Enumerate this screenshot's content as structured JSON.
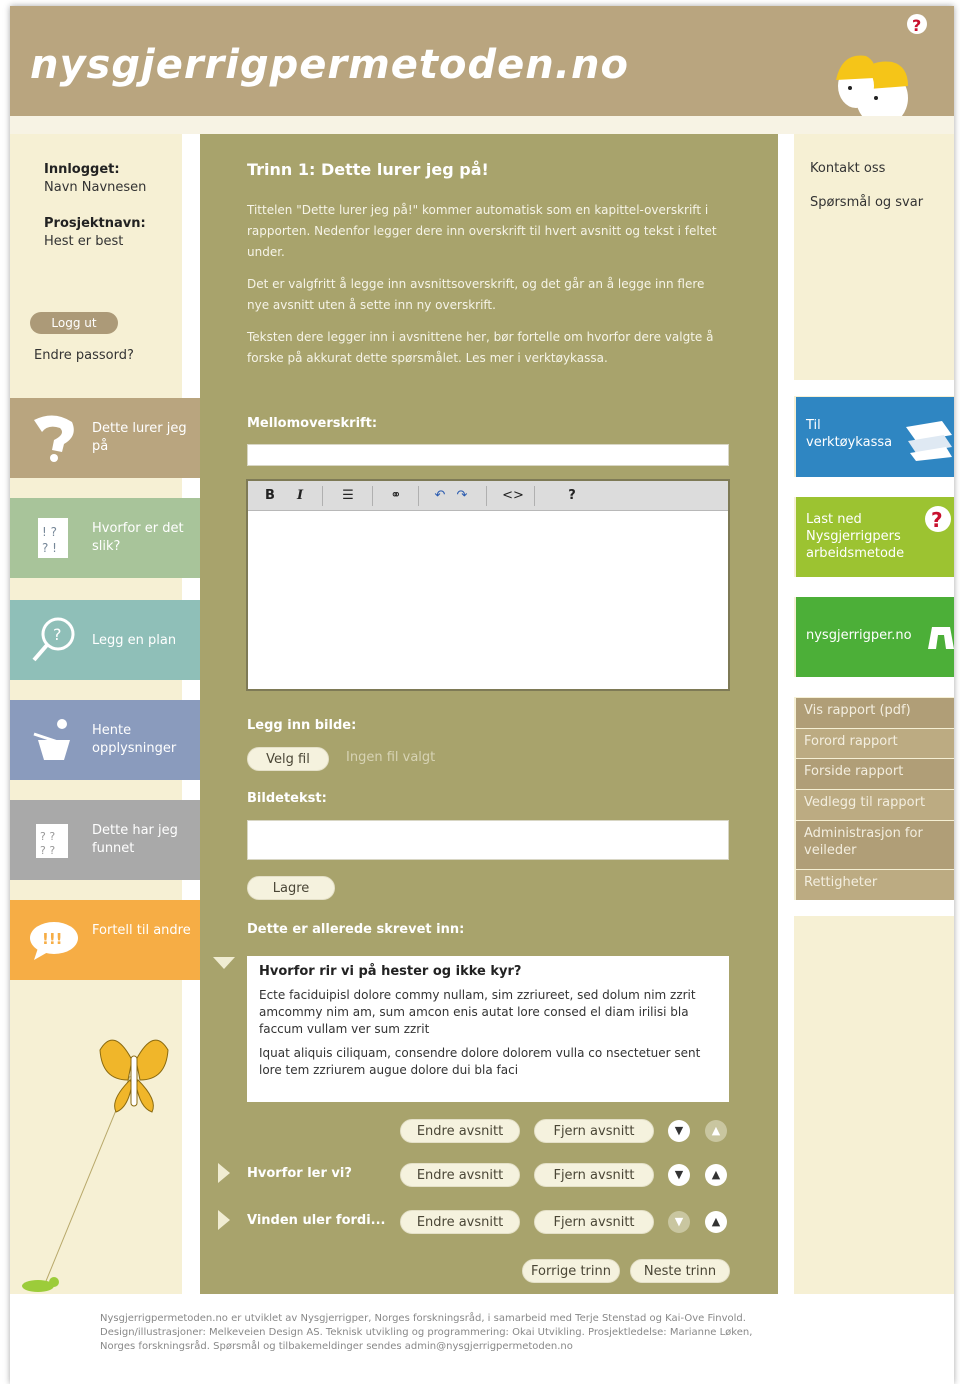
{
  "header": {
    "site_title": "nysgjerrigpermetoden.no"
  },
  "login": {
    "logged_in_label": "Innlogget:",
    "user_name": "Navn Navnesen",
    "project_label": "Prosjektnavn:",
    "project_name": "Hest er best",
    "logout_label": "Logg ut",
    "change_password": "Endre passord?"
  },
  "steps": [
    {
      "label": "Dette lurer jeg på",
      "color": "#b9a57f",
      "icon": "question-icon"
    },
    {
      "label": "Hvorfor er det slik?",
      "color": "#a8c49a",
      "icon": "idea-notes-icon"
    },
    {
      "label": "Legg en plan",
      "color": "#8fbfb8",
      "icon": "magnifier-icon"
    },
    {
      "label": "Hente opplysninger",
      "color": "#8a9bbd",
      "icon": "basket-icon"
    },
    {
      "label": "Dette har jeg funnet",
      "color": "#a9a9a9",
      "icon": "findings-icon"
    },
    {
      "label": "Fortell til andre",
      "color": "#f6ad45",
      "icon": "speech-bubble-icon"
    }
  ],
  "main": {
    "step_title": "Trinn 1: Dette lurer jeg på!",
    "intro_1": "Tittelen \"Dette lurer jeg på!\" kommer automatisk som en kapittel-overskrift i rapporten. Nedenfor legger dere inn overskrift til hvert avsnitt og tekst i feltet under.",
    "intro_2": "Det er valgfritt å legge inn avsnittsoverskrift, og det går an å legge inn flere nye avsnitt uten å sette inn ny overskrift.",
    "intro_3": "Teksten dere legger inn i avsnittene her, bør fortelle om hvorfor dere valgte å forske på akkurat dette spørsmålet. Les mer i verktøykassa.",
    "subheading_label": "Mellomoverskrift:",
    "toolbar": {
      "bold": "B",
      "italic": "I",
      "list": "☰",
      "link": "⚭",
      "undo": "↶",
      "redo": "↷",
      "code": "<>",
      "help": "?"
    },
    "image_label": "Legg inn bilde:",
    "choose_file": "Velg fil",
    "no_file": "Ingen fil valgt",
    "caption_label": "Bildetekst:",
    "save_label": "Lagre",
    "already_written": "Dette er allerede skrevet inn:",
    "entry": {
      "title": "Hvorfor rir vi på hester og ikke kyr?",
      "p1": "Ecte faciduipisl dolore commy nullam, sim zzriureet, sed dolum nim zzrit amcommy nim am, sum amcon enis autat lore consed el diam irilisi bla faccum vullam ver sum zzrit",
      "p2": "Iquat aliquis ciliquam, consendre dolore dolorem vulla co nsectetuer sent lore tem zzriurem augue dolore dui bla faci"
    },
    "sections": [
      {
        "title": "",
        "edit": "Endre avsnitt",
        "remove": "Fjern avsnitt"
      },
      {
        "title": "Hvorfor ler vi?",
        "edit": "Endre avsnitt",
        "remove": "Fjern avsnitt"
      },
      {
        "title": "Vinden uler fordi...",
        "edit": "Endre avsnitt",
        "remove": "Fjern avsnitt"
      }
    ],
    "prev_step": "Forrige trinn",
    "next_step": "Neste trinn"
  },
  "right": {
    "contact": "Kontakt oss",
    "faq": "Spørsmål og svar",
    "toolbox": "Til verktøykassa",
    "download": "Last ned Nysgjerrigpers arbeidsmetode",
    "nysgjerrigper": "nysgjerrigper.no",
    "report_links": [
      "Vis rapport (pdf)",
      "Forord rapport",
      "Forside rapport",
      "Vedlegg til rapport",
      "Administrasjon for veileder",
      "Rettigheter"
    ]
  },
  "footer": {
    "line1": "Nysgjerrigpermetoden.no er utviklet av Nysgjerrigper, Norges forskningsråd, i samarbeid med Terje Stenstad og Kai-Ove Finvold.",
    "line2": "Design/illustrasjoner: Melkeveien Design AS. Teknisk utvikling og programmering: Okai Utvikling. Prosjektledelse: Marianne Løken,",
    "line3": "Norges forskningsråd. Spørsmål og tilbakemeldinger sendes admin@nysgjerrigpermetoden.no"
  }
}
